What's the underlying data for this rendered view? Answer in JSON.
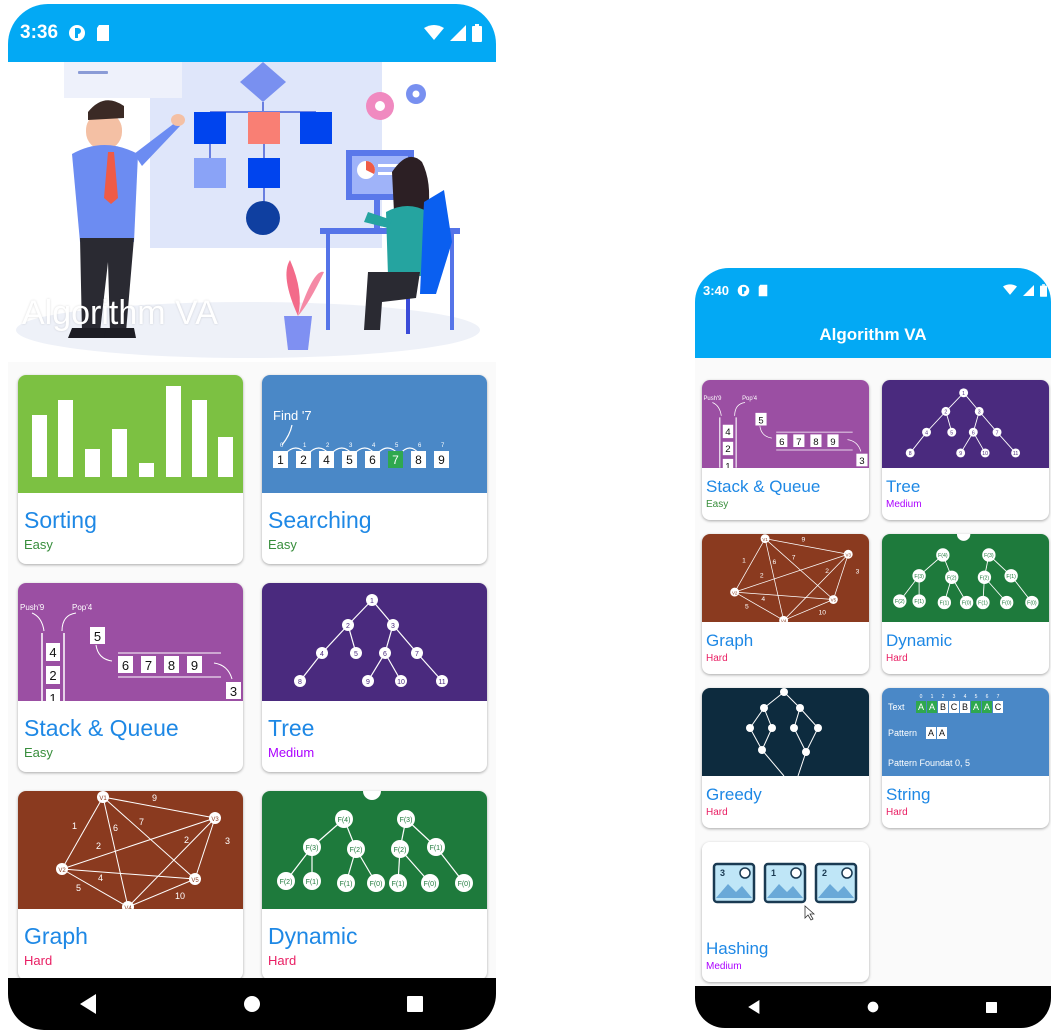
{
  "left_screen": {
    "status": {
      "time": "3:36"
    },
    "hero": {
      "title": "Algorithm VA"
    },
    "cards": [
      {
        "title": "Sorting",
        "difficulty": "Easy"
      },
      {
        "title": "Searching",
        "difficulty": "Easy"
      },
      {
        "title": "Stack & Queue",
        "difficulty": "Easy"
      },
      {
        "title": "Tree",
        "difficulty": "Medium"
      },
      {
        "title": "Graph",
        "difficulty": "Hard"
      },
      {
        "title": "Dynamic",
        "difficulty": "Hard"
      }
    ]
  },
  "right_screen": {
    "status": {
      "time": "3:40"
    },
    "app_bar": {
      "title": "Algorithm VA"
    },
    "cards": [
      {
        "title": "Stack & Queue",
        "difficulty": "Easy"
      },
      {
        "title": "Tree",
        "difficulty": "Medium"
      },
      {
        "title": "Graph",
        "difficulty": "Hard"
      },
      {
        "title": "Dynamic",
        "difficulty": "Hard"
      },
      {
        "title": "Greedy",
        "difficulty": "Hard"
      },
      {
        "title": "String",
        "difficulty": "Hard"
      },
      {
        "title": "Hashing",
        "difficulty": "Medium"
      }
    ]
  },
  "thumbnails": {
    "searching": {
      "prompt": "Find '7",
      "cells": [
        "1",
        "2",
        "4",
        "5",
        "6",
        "7",
        "8",
        "9"
      ],
      "indices": [
        "0",
        "1",
        "2",
        "3",
        "4",
        "5",
        "6",
        "7"
      ],
      "found": "7"
    },
    "stack": {
      "push_label": "Push'9",
      "pop_label": "Pop'4",
      "stack_cells": [
        "4",
        "2",
        "1"
      ],
      "incoming": "5",
      "queue_cells": [
        "6",
        "7",
        "8",
        "9"
      ],
      "dequeued": "3"
    },
    "tree": {
      "nodes": [
        "1",
        "2",
        "3",
        "4",
        "5",
        "6",
        "7",
        "8",
        "9",
        "10",
        "11"
      ]
    },
    "graph": {
      "vertices": [
        "V1",
        "V2",
        "V3",
        "V4",
        "V5"
      ],
      "weights": [
        "9",
        "1",
        "6",
        "7",
        "2",
        "2",
        "3",
        "4",
        "5",
        "10"
      ]
    },
    "dynamic": {
      "nodes": [
        "F(4)",
        "F(3)",
        "F(3)",
        "F(2)",
        "F(2)",
        "F(1)",
        "F(2)",
        "F(1)",
        "F(1)",
        "F(0)",
        "F(1)",
        "F(0)",
        "F(0)"
      ]
    },
    "string": {
      "text_label": "Text",
      "text_cells": [
        "A",
        "A",
        "B",
        "C",
        "B",
        "A",
        "A",
        "C"
      ],
      "text_indices": [
        "0",
        "1",
        "2",
        "3",
        "4",
        "5",
        "6",
        "7"
      ],
      "pattern_label": "Pattern",
      "pattern_cells": [
        "A",
        "A"
      ],
      "result": "Pattern Foundat 0, 5"
    },
    "hashing": {
      "slots": [
        "3",
        "1",
        "2"
      ]
    }
  },
  "colors": {
    "status_bar": "#03a9f4",
    "sorting_bg": "#7cc142",
    "searching_bg": "#4a88c7",
    "stack_bg": "#9b4fa3",
    "tree_bg": "#4a2a7e",
    "graph_bg": "#8a3a1f",
    "dynamic_bg": "#1e7a3c",
    "greedy_bg": "#0d2b3e",
    "string_bg": "#4a88c7",
    "title": "#1e88e5",
    "easy": "#388e3c",
    "medium": "#ab00ff",
    "hard": "#e91e63"
  }
}
